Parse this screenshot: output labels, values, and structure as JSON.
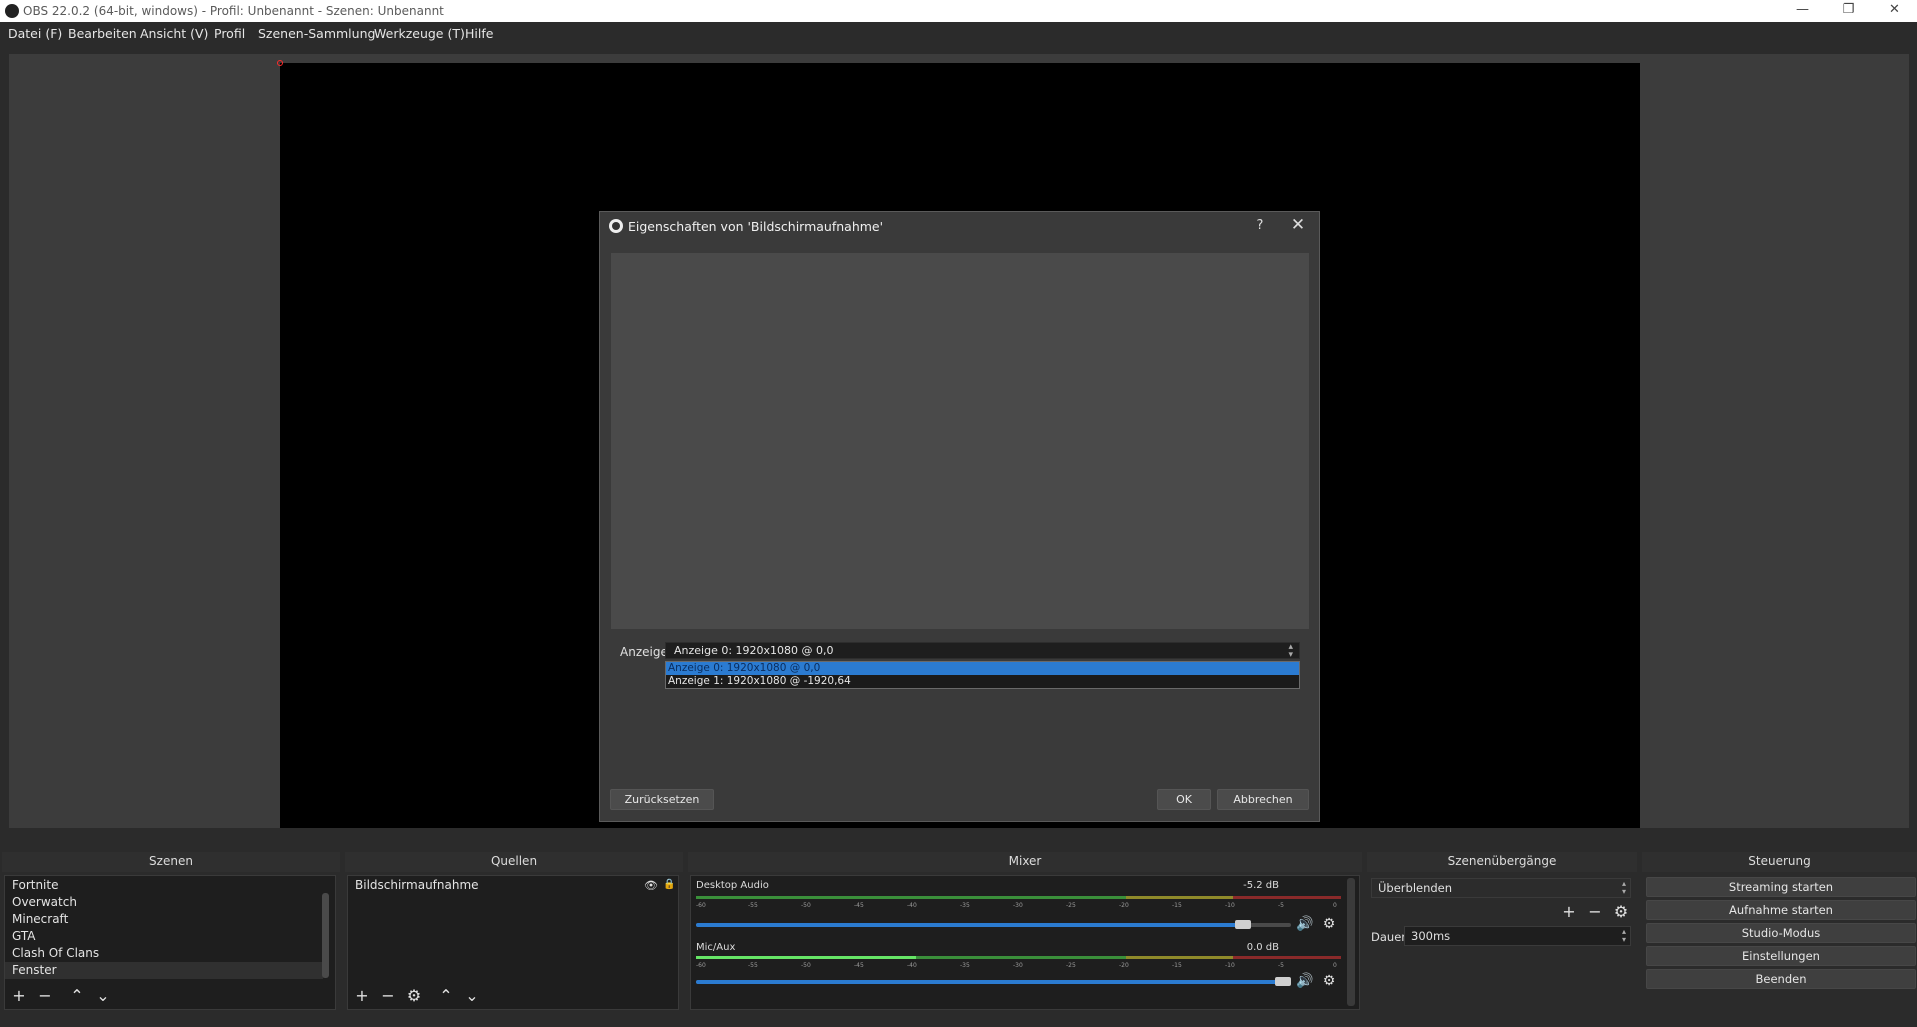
{
  "window": {
    "title": "OBS 22.0.2 (64-bit, windows) - Profil: Unbenannt - Szenen: Unbenannt",
    "controls": [
      "—",
      "❐",
      "✕"
    ]
  },
  "menu": [
    "Datei (F)",
    "Bearbeiten",
    "Ansicht (V)",
    "Profil",
    "Szenen-Sammlung",
    "Werkzeuge (T)",
    "Hilfe"
  ],
  "dialog": {
    "title": "Eigenschaften von 'Bildschirmaufnahme'",
    "help": "?",
    "close": "✕",
    "field_label": "Anzeige",
    "selected_value": "Anzeige 0: 1920x1080 @ 0,0",
    "options": [
      "Anzeige 0: 1920x1080 @ 0,0",
      "Anzeige 1: 1920x1080 @ -1920,64"
    ],
    "reset_label": "Zurücksetzen",
    "ok_label": "OK",
    "cancel_label": "Abbrechen"
  },
  "docks": {
    "scenes": {
      "title": "Szenen",
      "items": [
        "Fortnite",
        "Overwatch",
        "Minecraft",
        "GTA",
        "Clash Of Clans",
        "Fenster"
      ],
      "active": "Fenster"
    },
    "sources": {
      "title": "Quellen",
      "items": [
        "Bildschirmaufnahme"
      ]
    },
    "mixer": {
      "title": "Mixer",
      "ticks": [
        "-60",
        "-55",
        "-50",
        "-45",
        "-40",
        "-35",
        "-30",
        "-25",
        "-20",
        "-15",
        "-10",
        "-5",
        "0"
      ],
      "channels": [
        {
          "name": "Desktop Audio",
          "db": "-5.2 dB",
          "volume": 0.92
        },
        {
          "name": "Mic/Aux",
          "db": "0.0 dB",
          "volume": 1.0
        }
      ]
    },
    "transitions": {
      "title": "Szenenübergänge",
      "selected": "Überblenden",
      "duration_label": "Dauer",
      "duration_value": "300ms"
    },
    "controls": {
      "title": "Steuerung",
      "buttons": [
        "Streaming starten",
        "Aufnahme starten",
        "Studio-Modus",
        "Einstellungen",
        "Beenden"
      ]
    }
  },
  "colors": {
    "accent": "#2b7bd1",
    "background": "#2b2b2b",
    "meter_green": "#3a8f3a",
    "meter_yellow": "#8f8a2a",
    "meter_red": "#8a2a2a"
  }
}
